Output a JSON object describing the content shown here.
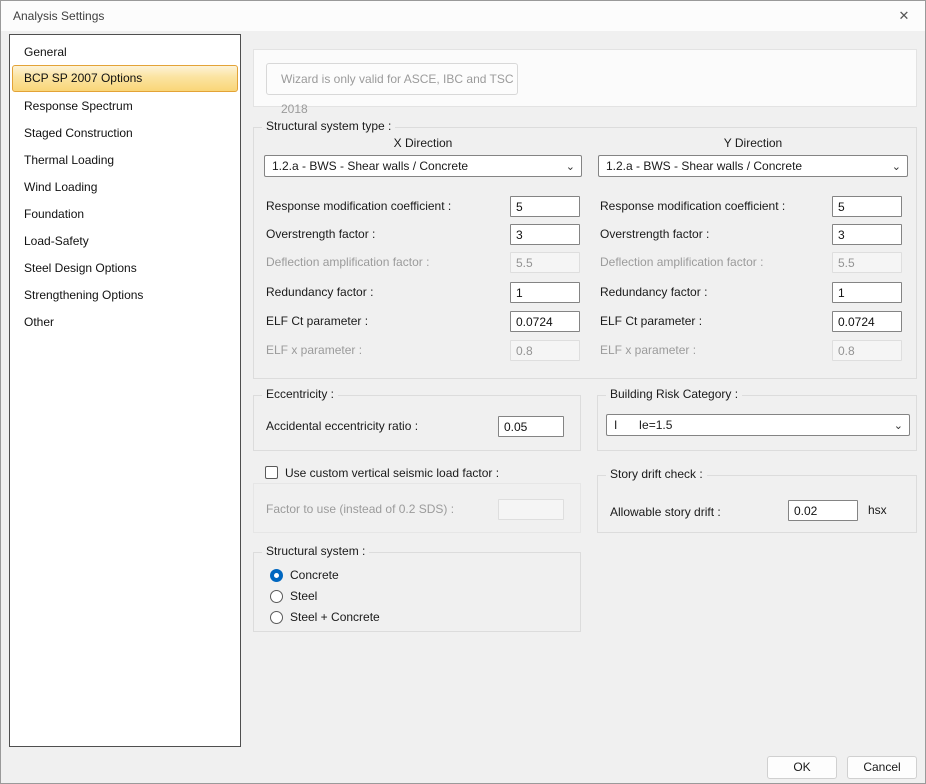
{
  "window": {
    "title": "Analysis Settings"
  },
  "icons": {
    "close": "✕",
    "chevron_down": "⌄"
  },
  "colors": {
    "selection_highlight": "#f9d678",
    "selection_border": "#e3a337",
    "radio_accent": "#0067c0"
  },
  "sidebar": {
    "items": [
      {
        "label": "General",
        "selected": false
      },
      {
        "label": "BCP SP 2007 Options",
        "selected": true
      },
      {
        "label": "Response Spectrum",
        "selected": false
      },
      {
        "label": "Staged Construction",
        "selected": false
      },
      {
        "label": "Thermal Loading",
        "selected": false
      },
      {
        "label": "Wind Loading",
        "selected": false
      },
      {
        "label": "Foundation",
        "selected": false
      },
      {
        "label": "Load-Safety",
        "selected": false
      },
      {
        "label": "Steel Design Options",
        "selected": false
      },
      {
        "label": "Strengthening Options",
        "selected": false
      },
      {
        "label": "Other",
        "selected": false
      }
    ]
  },
  "wizard": {
    "note": "Wizard is only valid for ASCE, IBC and TSC 2018"
  },
  "structural_type": {
    "title": "Structural system type :",
    "x": {
      "header": "X Direction",
      "dropdown": "1.2.a - BWS - Shear walls / Concrete",
      "fields": [
        {
          "label": "Response modification coefficient :",
          "value": "5",
          "disabled": false
        },
        {
          "label": "Overstrength factor :",
          "value": "3",
          "disabled": false
        },
        {
          "label": "Deflection amplification factor :",
          "value": "5.5",
          "disabled": true
        },
        {
          "label": "Redundancy factor :",
          "value": "1",
          "disabled": false
        },
        {
          "label": "ELF Ct parameter :",
          "value": "0.0724",
          "disabled": false
        },
        {
          "label": "ELF x parameter :",
          "value": "0.8",
          "disabled": true
        }
      ]
    },
    "y": {
      "header": "Y Direction",
      "dropdown": "1.2.a - BWS - Shear walls / Concrete",
      "fields": [
        {
          "label": "Response modification coefficient :",
          "value": "5",
          "disabled": false
        },
        {
          "label": "Overstrength factor :",
          "value": "3",
          "disabled": false
        },
        {
          "label": "Deflection amplification factor :",
          "value": "5.5",
          "disabled": true
        },
        {
          "label": "Redundancy factor :",
          "value": "1",
          "disabled": false
        },
        {
          "label": "ELF Ct parameter :",
          "value": "0.0724",
          "disabled": false
        },
        {
          "label": "ELF x parameter :",
          "value": "0.8",
          "disabled": true
        }
      ]
    }
  },
  "eccentricity": {
    "title": "Eccentricity :",
    "label": "Accidental eccentricity ratio :",
    "value": "0.05"
  },
  "risk": {
    "title": "Building Risk Category :",
    "category": "I",
    "detail": "Ie=1.5"
  },
  "vertical_seismic": {
    "checkbox_label": "Use custom vertical seismic load factor :",
    "checked": false,
    "factor_label": "Factor to use (instead of 0.2 SDS) :",
    "factor_value": ""
  },
  "story_drift": {
    "title": "Story drift check :",
    "label": "Allowable story drift :",
    "value": "0.02",
    "unit": "hsx"
  },
  "structural_system": {
    "title": "Structural system :",
    "options": [
      {
        "label": "Concrete",
        "selected": true
      },
      {
        "label": "Steel",
        "selected": false
      },
      {
        "label": "Steel + Concrete",
        "selected": false
      }
    ]
  },
  "footer": {
    "ok": "OK",
    "cancel": "Cancel"
  }
}
